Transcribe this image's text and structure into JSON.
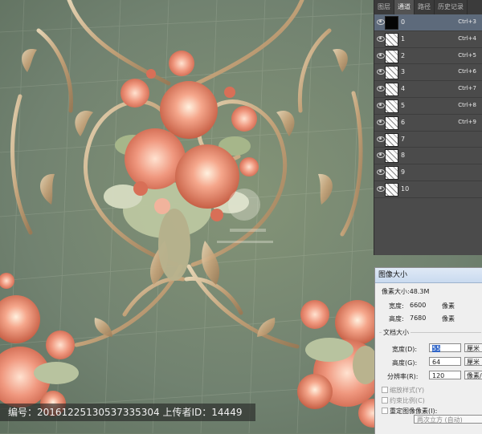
{
  "channels_panel": {
    "tabs": [
      {
        "label": "图层",
        "active": false
      },
      {
        "label": "通道",
        "active": true
      },
      {
        "label": "路径",
        "active": false
      },
      {
        "label": "历史记录",
        "active": false
      }
    ],
    "rows": [
      {
        "name": "0",
        "shortcut": "Ctrl+3",
        "thumb": "black",
        "active": true
      },
      {
        "name": "1",
        "shortcut": "Ctrl+4",
        "thumb": "noise",
        "active": false
      },
      {
        "name": "2",
        "shortcut": "Ctrl+5",
        "thumb": "noise",
        "active": false
      },
      {
        "name": "3",
        "shortcut": "Ctrl+6",
        "thumb": "noise",
        "active": false
      },
      {
        "name": "4",
        "shortcut": "Ctrl+7",
        "thumb": "noise",
        "active": false
      },
      {
        "name": "5",
        "shortcut": "Ctrl+8",
        "thumb": "noise",
        "active": false
      },
      {
        "name": "6",
        "shortcut": "Ctrl+9",
        "thumb": "noise",
        "active": false
      },
      {
        "name": "7",
        "shortcut": "",
        "thumb": "noise",
        "active": false
      },
      {
        "name": "8",
        "shortcut": "",
        "thumb": "noise",
        "active": false
      },
      {
        "name": "9",
        "shortcut": "",
        "thumb": "noise",
        "active": false
      },
      {
        "name": "10",
        "shortcut": "",
        "thumb": "noise",
        "active": false
      }
    ]
  },
  "image_size_dialog": {
    "title": "图像大小",
    "pixel_size_label": "像素大小:48.3M",
    "width_label": "宽度:",
    "width_value": "6600",
    "height_label": "高度:",
    "height_value": "7680",
    "pixel_unit": "像素",
    "doc_size_title": "文档大小",
    "doc_width_label": "宽度(D):",
    "doc_width_value": "55",
    "doc_height_label": "高度(G):",
    "doc_height_value": "64",
    "resolution_label": "分辨率(R):",
    "resolution_value": "120",
    "cm_unit": "厘米",
    "resolution_unit": "像素/厘米",
    "scale_styles": "缩放样式(Y)",
    "constrain_proportions": "约束比例(C)",
    "resample": "重定图像像素(I):",
    "resample_method": "两次立方 (自动)"
  },
  "watermark": {
    "text": "编号：20161225130537335304 上传者ID：14449"
  },
  "colors": {
    "background_green": "#6f7f6b",
    "flower_orange": "#e57c5f",
    "scroll_gold": "#c7ab82",
    "panel_dark": "#4b4b4b",
    "dialog_bg": "#efefef"
  }
}
